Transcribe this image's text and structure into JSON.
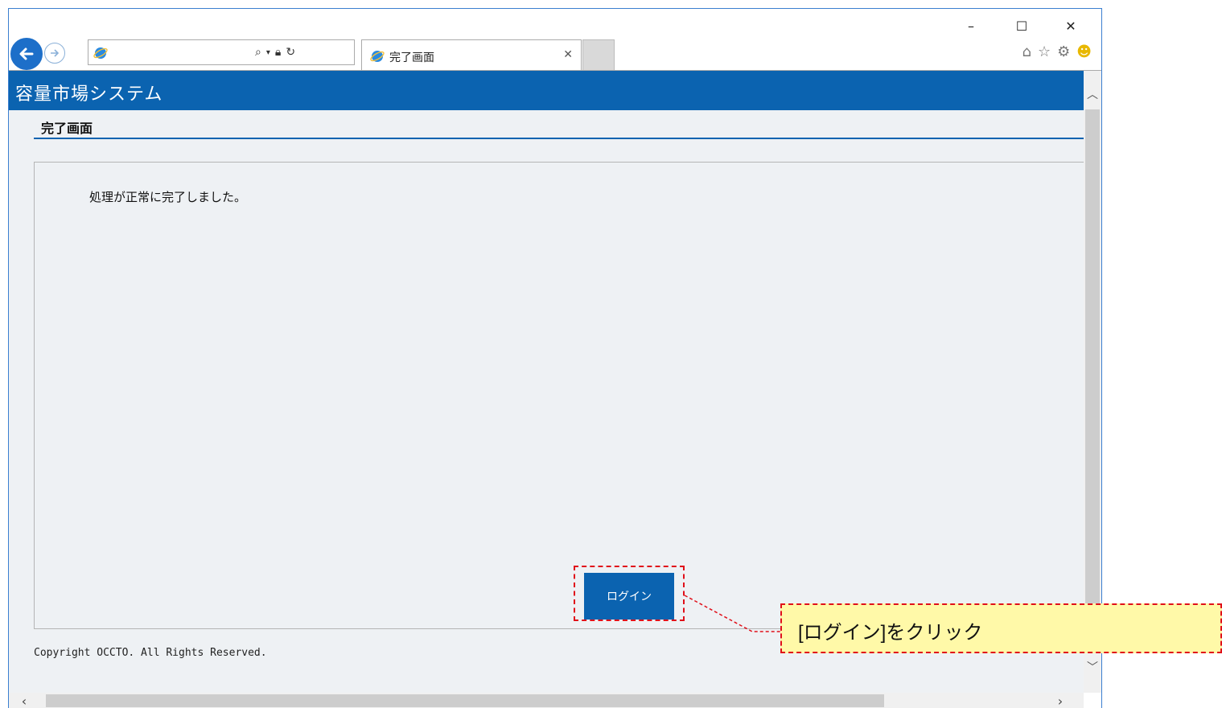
{
  "browser": {
    "tab_title": "完了画面",
    "window_controls": {
      "minimize": "–",
      "maximize": "☐",
      "close": "✕"
    },
    "toolbar_icons": [
      "home-icon",
      "favorites-star-icon",
      "settings-gear-icon",
      "feedback-smiley-icon"
    ]
  },
  "app": {
    "title": "容量市場システム"
  },
  "page": {
    "section_title": "完了画面",
    "message": "処理が正常に完了しました。",
    "login_button": "ログイン",
    "copyright": "Copyright OCCTO. All Rights Reserved."
  },
  "annotation": {
    "callout_text": "[ログイン]をクリック",
    "highlight_color": "#e0101a",
    "callout_bg": "#fff9a8"
  },
  "colors": {
    "brand_blue": "#0b63b0",
    "page_bg": "#eef1f4"
  }
}
